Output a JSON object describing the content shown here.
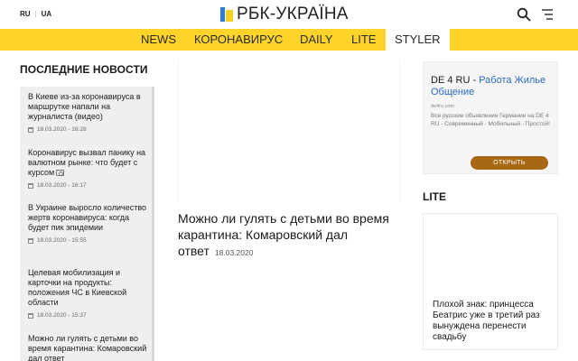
{
  "header": {
    "lang_ru": "RU",
    "lang_sep": "|",
    "lang_ua": "UA",
    "logo_text": "РБК-УКРАЇНА",
    "search_icon": "search-icon",
    "menu_icon": "menu-icon"
  },
  "nav": {
    "items": [
      {
        "label": "NEWS",
        "active": false
      },
      {
        "label": "КОРОНАВИРУС",
        "active": false
      },
      {
        "label": "DAILY",
        "active": false
      },
      {
        "label": "LITE",
        "active": false
      },
      {
        "label": "STYLER",
        "active": true
      }
    ]
  },
  "left": {
    "title": "ПОСЛЕДНИЕ НОВОСТИ",
    "news": [
      {
        "text": "В Киеве из-за коронавируса в маршрутке напали на журналиста (видео)",
        "date": "18.03.2020 - 16:28",
        "camera": false
      },
      {
        "text": "Коронавирус вызвал панику на валютном рынке: что будет с курсом",
        "date": "18.03.2020 - 16:17",
        "camera": true
      },
      {
        "text": "В Украине выросло количество жертв коронавируса: когда будет пик эпидемии",
        "date": "18.03.2020 - 15:55",
        "camera": false
      },
      {
        "text": "Целевая мобилизация и карточки на продукты: положения ЧС в Киевской области",
        "date": "18.03.2020 - 15:37",
        "camera": false
      },
      {
        "text": "Можно ли гулять с детьми во время карантина: Комаровский дал ответ",
        "date": "",
        "camera": false
      }
    ]
  },
  "center": {
    "headline": "Можно ли гулять с детьми во время карантина: Комаровский дал ответ",
    "date": "18.03.2020"
  },
  "ad": {
    "brand": "DE 4 RU",
    "dash": " - ",
    "link": "Работа Жилье Общение",
    "domain": "de4ru.com",
    "description": "Все русские объявления Германии на DE 4 RU - Современный - Мобильный - Простой!",
    "button": "ОТКРЫТЬ",
    "button_color": "#a86712"
  },
  "lite": {
    "title": "LITE",
    "card_text": "Плохой знак: принцесса Беатрис уже в третий раз вынуждена перенести свадьбу"
  },
  "colors": {
    "nav_bg": "#ffd42a",
    "news_bg": "#efefef",
    "logo_blue": "#2a7fd4",
    "logo_yellow": "#f5d21e",
    "ad_link": "#2a6cc0"
  }
}
